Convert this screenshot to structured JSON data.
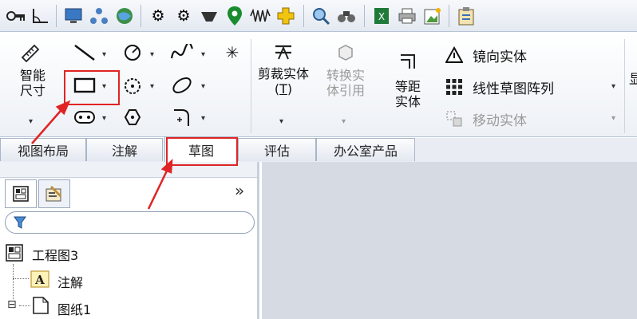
{
  "toolbar": {
    "icons": [
      "key-icon",
      "angle-icon",
      "monitor-icon",
      "network-icon",
      "globe-icon",
      "gear-icon",
      "gear-dark-icon",
      "bowl-icon",
      "location-pin-icon",
      "wave-icon",
      "cross-icon",
      "magnifier-icon",
      "binoculars-icon",
      "excel-icon",
      "printer-icon",
      "picture-icon",
      "clipboard-icon"
    ]
  },
  "ribbon": {
    "smart_dimension": "智能尺寸",
    "trim": "剪裁实体",
    "trim_key": "T",
    "convert": "转换实体引用",
    "offset": "等距实体",
    "mirror": "镜向实体",
    "linear_pattern": "线性草图阵列",
    "move": "移动实体",
    "cut_off_char": "显"
  },
  "tabs": [
    "视图布局",
    "注解",
    "草图",
    "评估",
    "办公室产品"
  ],
  "active_tab": "草图",
  "panel": {
    "expand_glyph": "»",
    "tree": {
      "root": "工程图3",
      "annotation": "注解",
      "sheet": "图纸1",
      "expander": "⊟"
    }
  },
  "colors": {
    "highlight_red": "#e02424"
  }
}
